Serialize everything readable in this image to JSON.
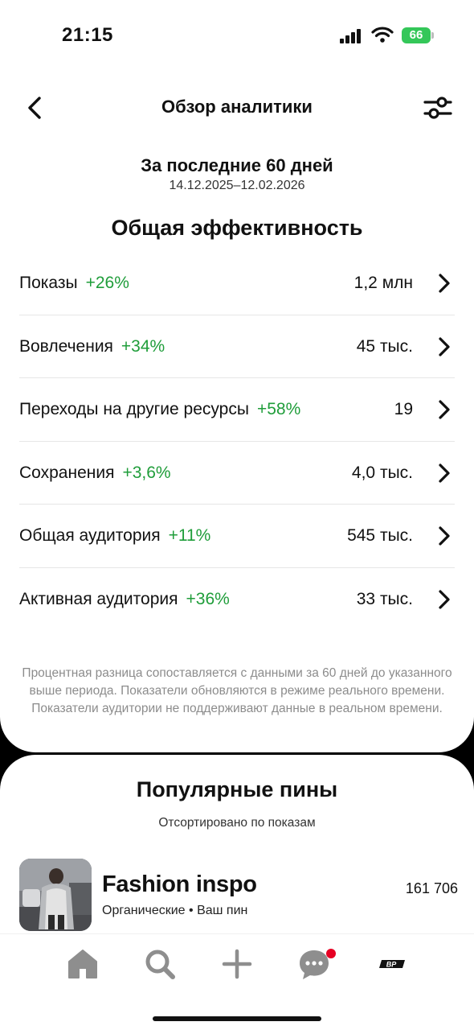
{
  "status": {
    "time": "21:15",
    "battery": "66"
  },
  "nav": {
    "title": "Обзор аналитики"
  },
  "period": {
    "title": "За последние 60 дней",
    "range": "14.12.2025–12.02.2026"
  },
  "overall_title": "Общая эффективность",
  "metrics": [
    {
      "label": "Показы",
      "delta": "+26%",
      "value": "1,2 млн"
    },
    {
      "label": "Вовлечения",
      "delta": "+34%",
      "value": "45 тыс."
    },
    {
      "label": "Переходы на другие ресурсы",
      "delta": "+58%",
      "value": "19"
    },
    {
      "label": "Сохранения",
      "delta": "+3,6%",
      "value": "4,0 тыс."
    },
    {
      "label": "Общая аудитория",
      "delta": "+11%",
      "value": "545 тыс."
    },
    {
      "label": "Активная аудитория",
      "delta": "+36%",
      "value": "33 тыс."
    }
  ],
  "footnote": "Процентная разница сопоставляется с данными за 60 дней до указанного выше периода. Показатели обновляются в режиме реального времени. Показатели аудитории не поддерживают данные в реальном времени.",
  "popular_pins": {
    "title": "Популярные пины",
    "sort_label": "Отсортировано по показам",
    "items": [
      {
        "name": "Fashion inspo",
        "meta": "Органические • Ваш пин",
        "count": "161 706"
      }
    ]
  },
  "tabs": [
    {
      "icon": "home-icon"
    },
    {
      "icon": "search-icon"
    },
    {
      "icon": "plus-icon"
    },
    {
      "icon": "messages-icon",
      "badge": true
    },
    {
      "icon": "profile-icon"
    }
  ],
  "profile_avatar_text": "BP",
  "colors": {
    "positive": "#1f9d3a",
    "battery": "#34c759",
    "badge": "#e60023"
  }
}
